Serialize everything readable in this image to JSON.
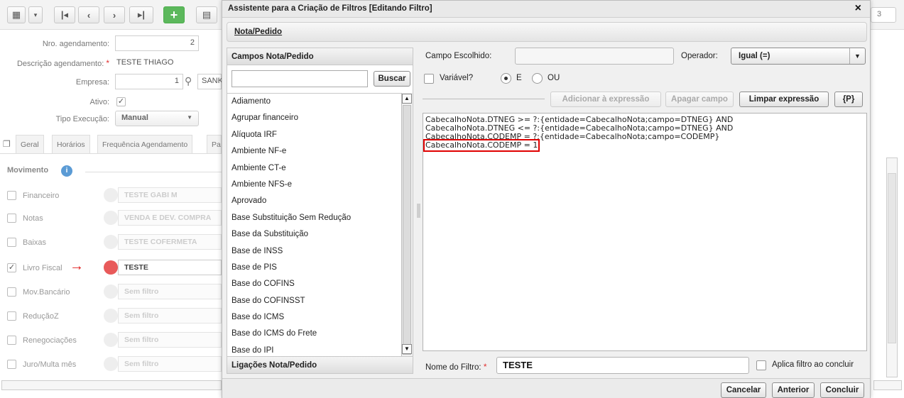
{
  "background": {
    "toolbar": {
      "page_value": "3"
    },
    "fields": {
      "nro_label": "Nro. agendamento:",
      "nro_value": "2",
      "descricao_label": "Descrição agendamento:",
      "descricao_value": "TESTE THIAGO",
      "empresa_label": "Empresa:",
      "empresa_value": "1",
      "empresa_name": "SANK",
      "ativo_label": "Ativo:",
      "tipo_label": "Tipo Execução:",
      "tipo_value": "Manual"
    },
    "tabs": [
      "Geral",
      "Horários",
      "Frequência Agendamento",
      "Pa"
    ],
    "movimento_title": "Movimento",
    "movimento_rows": [
      {
        "label": "Financeiro",
        "value": "TESTE GABI M",
        "checked": false
      },
      {
        "label": "Notas",
        "value": "VENDA E DEV. COMPRA",
        "checked": false
      },
      {
        "label": "Baixas",
        "value": "TESTE COFERMETA",
        "checked": false
      },
      {
        "label": "Livro Fiscal",
        "value": "TESTE",
        "checked": true
      },
      {
        "label": "Mov.Bancário",
        "value": "Sem filtro",
        "checked": false
      },
      {
        "label": "ReduçãoZ",
        "value": "Sem filtro",
        "checked": false
      },
      {
        "label": "Renegociações",
        "value": "Sem filtro",
        "checked": false
      },
      {
        "label": "Juro/Multa mês",
        "value": "Sem filtro",
        "checked": false
      }
    ]
  },
  "dialog": {
    "title": "Assistente para a Criação de Filtros  [Editando Filtro]",
    "close_icon": "×",
    "tab_label": "Nota/Pedido",
    "left_panel": {
      "header": "Campos Nota/Pedido",
      "search_button": "Buscar",
      "items": [
        "Adiamento",
        "Agrupar financeiro",
        "Alíquota IRF",
        "Ambiente  NF-e",
        "Ambiente CT-e",
        "Ambiente NFS-e",
        "Aprovado",
        "Base Substituição Sem Redução",
        "Base da Substituição",
        "Base de INSS",
        "Base de PIS",
        "Base do COFINS",
        "Base do COFINSST",
        "Base do ICMS",
        "Base do ICMS do Frete",
        "Base do IPI"
      ],
      "footer": "Ligações Nota/Pedido"
    },
    "right_panel": {
      "campo_label": "Campo Escolhido:",
      "operador_label": "Operador:",
      "operador_value": "Igual (=)",
      "variavel_label": "Variável?",
      "radio_e_label": "E",
      "radio_ou_label": "OU",
      "btn_adicionar": "Adicionar à expressão",
      "btn_apagar": "Apagar campo",
      "btn_limpar": "Limpar expressão",
      "btn_p": "{P}",
      "expression_lines": [
        "CabecalhoNota.DTNEG >= ?:{entidade=CabecalhoNota;campo=DTNEG} AND",
        "CabecalhoNota.DTNEG <= ?:{entidade=CabecalhoNota;campo=DTNEG} AND",
        "CabecalhoNota.CODEMP = ?:{entidade=CabecalhoNota;campo=CODEMP}",
        "CabecalhoNota.CODEMP = 1"
      ],
      "nome_label": "Nome do Filtro:",
      "nome_value": "TESTE",
      "aplica_label": "Aplica filtro ao concluir"
    },
    "footer_buttons": {
      "cancelar": "Cancelar",
      "anterior": "Anterior",
      "concluir": "Concluir"
    }
  }
}
